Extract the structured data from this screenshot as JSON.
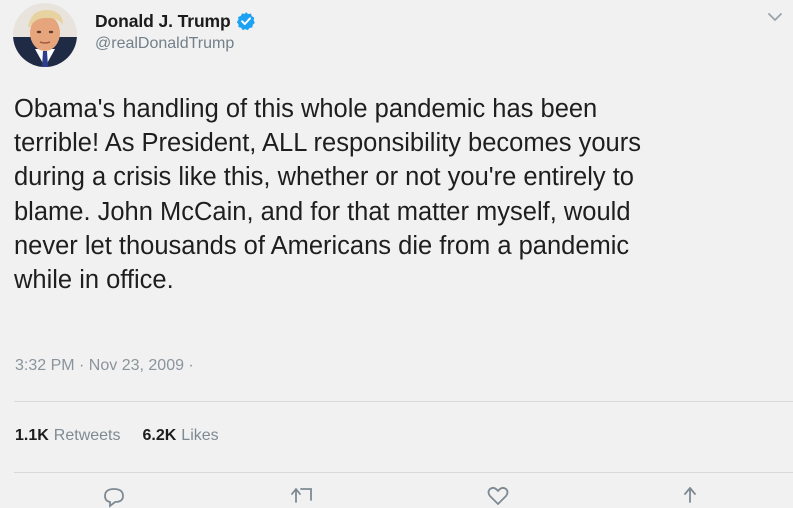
{
  "tweet": {
    "author": {
      "name": "Donald J. Trump",
      "handle": "@realDonaldTrump",
      "verified": true
    },
    "text": "Obama's handling of this whole pandemic has been\nterrible! As President, ALL responsibility becomes yours\nduring a crisis like this, whether or not you're entirely to\nblame. John McCain, and for that matter myself, would\nnever let thousands of Americans die from a pandemic\nwhile in office.",
    "timestamp": "3:32 PM · Nov 23, 2009 ·",
    "stats": {
      "retweets": {
        "count": "1.1K",
        "label": "Retweets"
      },
      "likes": {
        "count": "6.2K",
        "label": "Likes"
      }
    },
    "actions": [
      "reply-icon",
      "retweet-icon",
      "like-icon",
      "share-icon"
    ]
  },
  "colors": {
    "background": "#f1f1f1",
    "verified_blue": "#1da1f2",
    "muted_text": "#72808a",
    "divider": "#d6dadd"
  }
}
